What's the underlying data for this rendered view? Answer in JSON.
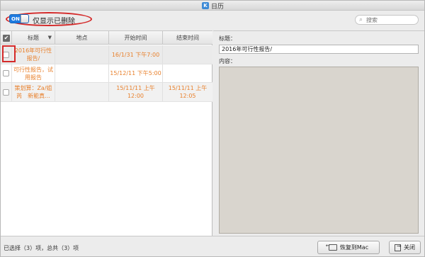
{
  "window": {
    "title": "日历"
  },
  "toolbar": {
    "toggle_state": "ON",
    "toggle_label": "仅显示已删除",
    "search_placeholder": "搜索"
  },
  "table": {
    "columns": [
      "标题",
      "地点",
      "开始时间",
      "结束时间"
    ],
    "rows": [
      {
        "title": "2016年可行性报告/",
        "place": "",
        "start": "16/1/31 下午7:00",
        "end": ""
      },
      {
        "title": "可行性报告，试用报告",
        "place": "",
        "start": "15/12/11 下午5:00",
        "end": ""
      },
      {
        "title": "策划算：Za/姐芮　新能真...",
        "place": "",
        "start": "15/11/11 上午12:00",
        "end": "15/11/11 上午12:05"
      }
    ]
  },
  "detail": {
    "title_label": "标题：",
    "title_value": "2016年可行性报告/",
    "content_label": "内容："
  },
  "status": {
    "summary": "已选择（3）项，总共（3）项"
  },
  "buttons": {
    "restore": "恢复到Mac",
    "close": "关闭"
  },
  "colors": {
    "row_text": "#e8802c",
    "toggle_on": "#1e7be0",
    "highlight": "#d42a2a",
    "content_bg": "#d9d5ce"
  }
}
